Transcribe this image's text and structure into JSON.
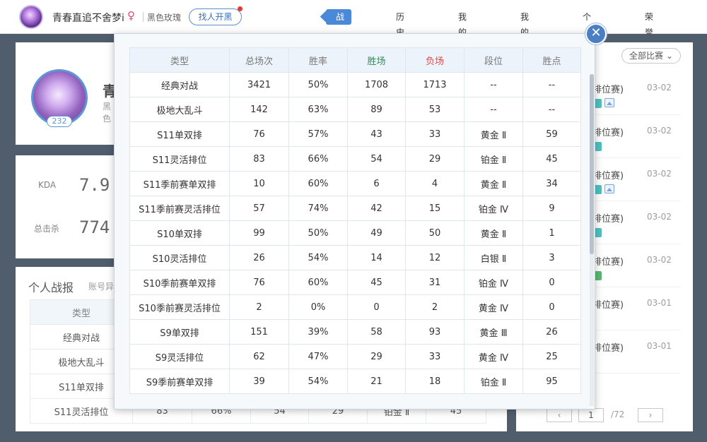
{
  "header": {
    "username": "青春直追不舍梦i",
    "gender_icon": "female-icon",
    "rank_title": "黑色玫瑰",
    "blacklist_label": "找人开黑",
    "tabs": [
      {
        "label": "战绩总览",
        "active": true
      },
      {
        "label": "历史战绩",
        "active": false
      },
      {
        "label": "我的英雄",
        "active": false
      },
      {
        "label": "我的皮肤",
        "active": false
      },
      {
        "label": "个人荣誉",
        "active": false
      },
      {
        "label": "荣誉截图",
        "active": false
      }
    ]
  },
  "profile": {
    "name_initial": "青",
    "subtitle": "黑色",
    "level": "232"
  },
  "stats": {
    "kda_label": "KDA",
    "kda_value": "7.9",
    "kills_label": "总击杀",
    "kills_value": "774"
  },
  "report": {
    "title": "个人战报",
    "subtitle": "账号异",
    "header": "类型",
    "rows": [
      {
        "type": "经典对战",
        "total": "",
        "rate": "",
        "win": "",
        "lose": "",
        "rank": "",
        "pts": ""
      },
      {
        "type": "极地大乱斗",
        "total": "",
        "rate": "",
        "win": "",
        "lose": "",
        "rank": "",
        "pts": ""
      },
      {
        "type": "S11单双排",
        "total": "",
        "rate": "",
        "win": "",
        "lose": "",
        "rank": "",
        "pts": ""
      },
      {
        "type": "S11灵活排位",
        "total": "83",
        "rate": "66%",
        "win": "54",
        "lose": "29",
        "rank": "铂金 Ⅱ",
        "pts": "45"
      }
    ]
  },
  "matches": {
    "filter_label": "全部比赛",
    "items": [
      {
        "type": "排位赛)",
        "date": "03-02"
      },
      {
        "type": "排位赛)",
        "date": "03-02"
      },
      {
        "type": "排位赛)",
        "date": "03-02"
      },
      {
        "type": "排位赛)",
        "date": "03-02"
      },
      {
        "type": "排位赛)",
        "date": "03-02"
      },
      {
        "type": "排位赛)",
        "date": "03-01"
      },
      {
        "type": "排位赛)",
        "date": "03-01"
      }
    ],
    "pager": {
      "prev": "‹",
      "next": "›",
      "current": "1",
      "total": "/72"
    }
  },
  "modal": {
    "close_label": "✕",
    "columns": {
      "type": "类型",
      "total": "总场次",
      "rate": "胜率",
      "win": "胜场",
      "lose": "负场",
      "rank": "段位",
      "pts": "胜点"
    },
    "colors": {
      "win": "#2e8b57",
      "lose": "#e04a4a",
      "accent": "#4a88d8"
    },
    "rows": [
      {
        "type": "经典对战",
        "total": "3421",
        "rate": "50%",
        "win": "1708",
        "lose": "1713",
        "rank": "--",
        "pts": "--"
      },
      {
        "type": "极地大乱斗",
        "total": "142",
        "rate": "63%",
        "win": "89",
        "lose": "53",
        "rank": "--",
        "pts": "--"
      },
      {
        "type": "S11单双排",
        "total": "76",
        "rate": "57%",
        "win": "43",
        "lose": "33",
        "rank": "黄金 Ⅱ",
        "pts": "59"
      },
      {
        "type": "S11灵活排位",
        "total": "83",
        "rate": "66%",
        "win": "54",
        "lose": "29",
        "rank": "铂金 Ⅱ",
        "pts": "45"
      },
      {
        "type": "S11季前赛单双排",
        "total": "10",
        "rate": "60%",
        "win": "6",
        "lose": "4",
        "rank": "黄金 Ⅱ",
        "pts": "34"
      },
      {
        "type": "S11季前赛灵活排位",
        "total": "57",
        "rate": "74%",
        "win": "42",
        "lose": "15",
        "rank": "铂金 Ⅳ",
        "pts": "9"
      },
      {
        "type": "S10单双排",
        "total": "99",
        "rate": "50%",
        "win": "49",
        "lose": "50",
        "rank": "黄金 Ⅱ",
        "pts": "1"
      },
      {
        "type": "S10灵活排位",
        "total": "26",
        "rate": "54%",
        "win": "14",
        "lose": "12",
        "rank": "白银 Ⅱ",
        "pts": "3"
      },
      {
        "type": "S10季前赛单双排",
        "total": "76",
        "rate": "60%",
        "win": "45",
        "lose": "31",
        "rank": "铂金 Ⅳ",
        "pts": "0"
      },
      {
        "type": "S10季前赛灵活排位",
        "total": "2",
        "rate": "0%",
        "win": "0",
        "lose": "2",
        "rank": "黄金 Ⅳ",
        "pts": "0"
      },
      {
        "type": "S9单双排",
        "total": "151",
        "rate": "39%",
        "win": "58",
        "lose": "93",
        "rank": "黄金 Ⅲ",
        "pts": "26"
      },
      {
        "type": "S9灵活排位",
        "total": "62",
        "rate": "47%",
        "win": "29",
        "lose": "33",
        "rank": "黄金 Ⅳ",
        "pts": "25"
      },
      {
        "type": "S9季前赛单双排",
        "total": "39",
        "rate": "54%",
        "win": "21",
        "lose": "18",
        "rank": "铂金 Ⅱ",
        "pts": "95"
      }
    ]
  }
}
